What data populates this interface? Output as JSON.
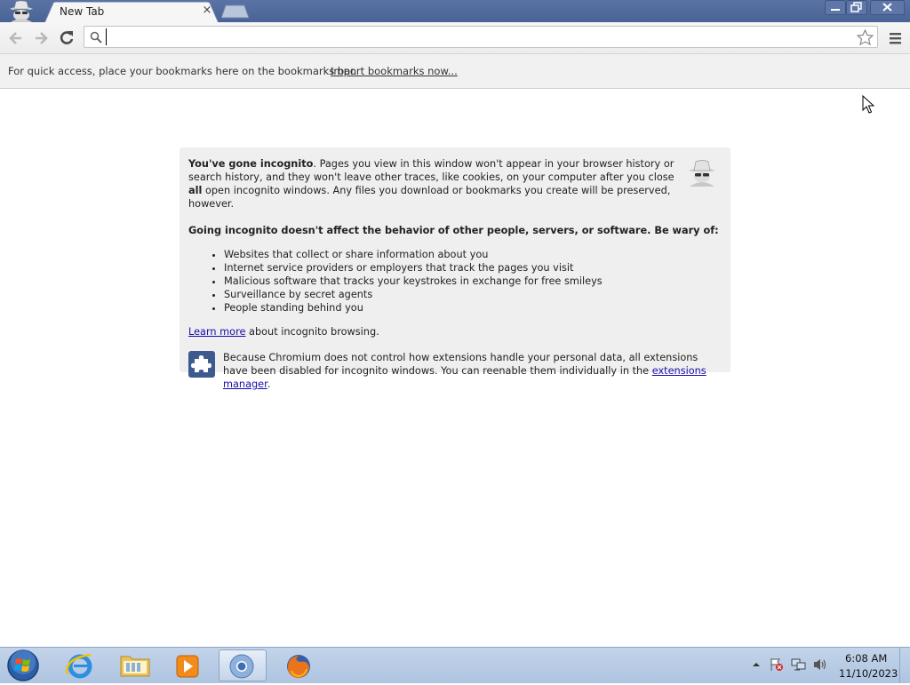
{
  "browser": {
    "tab_title": "New Tab",
    "tab_close": "×",
    "omnibox_value": "",
    "icons": [
      "incognito-avatar-icon",
      "back-arrow-icon",
      "forward-arrow-icon",
      "reload-icon",
      "search-icon",
      "star-icon",
      "menu-icon"
    ]
  },
  "bookmarks_bar": {
    "text": "For quick access, place your bookmarks here on the bookmarks bar.",
    "import_link": "Import bookmarks now..."
  },
  "incognito_card": {
    "p1_bold": "You've gone incognito",
    "p1_text_a": ". Pages you view in this window won't appear in your browser history or search history, and they won't leave other traces, like cookies, on your computer after you close ",
    "p1_bold2": "all",
    "p1_text_b": " open incognito windows. Any files you download or bookmarks you create will be preserved, however.",
    "p2": "Going incognito doesn't affect the behavior of other people, servers, or software. Be wary of:",
    "list": [
      "Websites that collect or share information about you",
      "Internet service providers or employers that track the pages you visit",
      "Malicious software that tracks your keystrokes in exchange for free smileys",
      "Surveillance by secret agents",
      "People standing behind you"
    ],
    "learn_more": "Learn more",
    "learn_more_rest": " about incognito browsing.",
    "ext_text": "Because Chromium does not control how extensions handle your personal data, all extensions have been disabled for incognito windows. You can reenable them individually in the ",
    "ext_link": "extensions manager",
    "ext_end": "."
  },
  "taskbar": {
    "apps": [
      "Internet Explorer",
      "Windows Explorer",
      "Media Player",
      "Chromium",
      "Firefox"
    ],
    "clock_time": "6:08 AM",
    "clock_date": "11/10/2023"
  },
  "colors": {
    "titlebar": "#4f689b",
    "link": "#1a0dab",
    "card_bg": "#efefef",
    "taskbar": "#b8cce4"
  }
}
